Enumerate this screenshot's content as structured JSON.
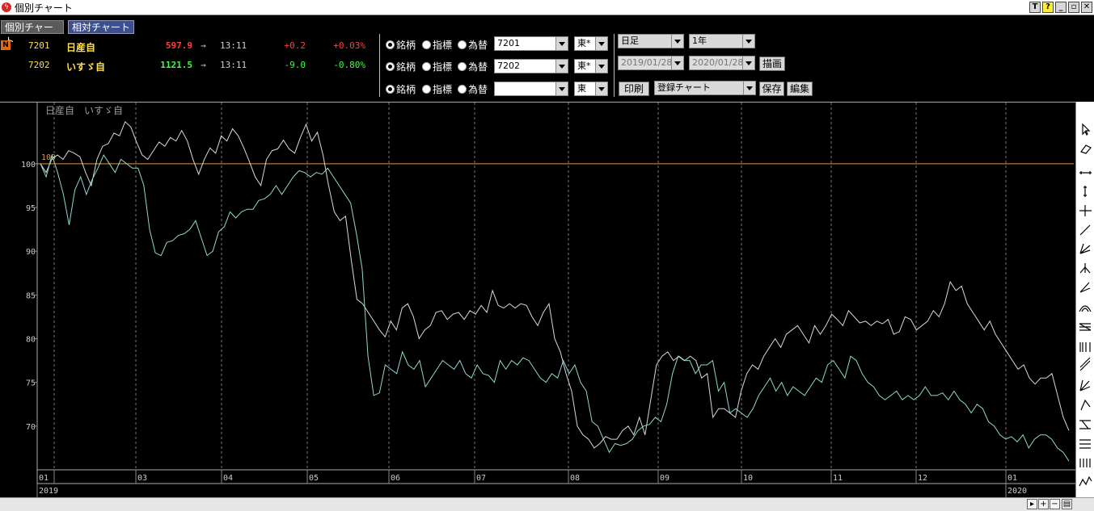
{
  "window": {
    "title": "個別チャート",
    "buttons": [
      "T",
      "?",
      "_",
      "▫",
      "✕"
    ]
  },
  "tabs": [
    {
      "label": "個別チャート",
      "active": false
    },
    {
      "label": "相対チャート",
      "active": true
    }
  ],
  "realtime_badge": "N",
  "quotes": [
    {
      "code": "7201",
      "name": "日産自",
      "price": "597.9",
      "price_color": "#ff4040",
      "arrow": "→",
      "time": "13:11",
      "change": "+0.2",
      "pct": "+0.03%",
      "change_color": "#ff4040"
    },
    {
      "code": "7202",
      "name": "いすゞ自",
      "price": "1121.5",
      "price_color": "#40ff40",
      "arrow": "→",
      "time": "13:11",
      "change": "-9.0",
      "pct": "-0.80%",
      "change_color": "#40ff40"
    }
  ],
  "selectors": [
    {
      "options": [
        "銘柄",
        "指標",
        "為替"
      ],
      "selected": 0,
      "code": "7201",
      "market": "東*"
    },
    {
      "options": [
        "銘柄",
        "指標",
        "為替"
      ],
      "selected": 0,
      "code": "7202",
      "market": "東*"
    },
    {
      "options": [
        "銘柄",
        "指標",
        "為替"
      ],
      "selected": 0,
      "code": "",
      "market": "東"
    }
  ],
  "controls": {
    "period": "日足",
    "span": "1年",
    "date_from": "2019/01/28",
    "date_to": "2020/01/28",
    "draw_button": "描画",
    "print_button": "印刷",
    "saved_chart": "登録チャート",
    "save_button": "保存",
    "edit_button": "編集"
  },
  "chart_data": {
    "type": "line",
    "legend": [
      "日産自",
      "いすゞ自"
    ],
    "baseline": 100,
    "baseline_label": "100",
    "ylim": [
      65,
      107
    ],
    "yticks": [
      70,
      75,
      80,
      85,
      90,
      95,
      100
    ],
    "x_month_labels": [
      "01",
      "03",
      "04",
      "05",
      "06",
      "07",
      "08",
      "09",
      "10",
      "11",
      "12",
      "01"
    ],
    "x_year_labels": [
      "2019",
      "2020"
    ],
    "series": [
      {
        "name": "日産自",
        "color": "#d8d8d8",
        "values": [
          100,
          99,
          100.5,
          101,
          100.5,
          101.5,
          101.2,
          100.8,
          99,
          97.5,
          100.5,
          102,
          102.3,
          103.5,
          103.2,
          104.8,
          104.2,
          102.5,
          101,
          100.5,
          101.5,
          102.5,
          102,
          103,
          102.6,
          103.8,
          102.6,
          100.5,
          98.8,
          100.5,
          101.8,
          101.2,
          103.2,
          102.6,
          104,
          103.2,
          101.8,
          100.2,
          98.5,
          97.5,
          100.5,
          101.5,
          101.7,
          102.7,
          101.7,
          101.2,
          103,
          104.5,
          102.6,
          103.6,
          101,
          97.5,
          94.5,
          93.5,
          94,
          89,
          84.5,
          84,
          83,
          82,
          81,
          80.2,
          82,
          81,
          83.5,
          84,
          82.5,
          80,
          81,
          81.5,
          83,
          83.2,
          82.2,
          82.8,
          83,
          82.2,
          83.2,
          82.8,
          83.8,
          83,
          85.5,
          83.8,
          83.5,
          84,
          83.5,
          84,
          83.8,
          82.5,
          81.5,
          83,
          84,
          80,
          78.5,
          76,
          74,
          70,
          69,
          68.5,
          67.5,
          68,
          68.8,
          68.5,
          68.5,
          69.5,
          70,
          69,
          71,
          69,
          73,
          77,
          78,
          78.5,
          77.5,
          78,
          77.5,
          78,
          77.5,
          75.5,
          76,
          71,
          72,
          72,
          71.5,
          71,
          74,
          76,
          77,
          76.5,
          78,
          79,
          80,
          79,
          80.5,
          81,
          81.5,
          80.5,
          79.5,
          81.5,
          80.5,
          81.5,
          82.8,
          82.2,
          81.5,
          83.2,
          82.5,
          81.8,
          82,
          81.5,
          82,
          81.7,
          82.2,
          80.5,
          80.8,
          82.5,
          82.2,
          81,
          81.5,
          82,
          83.2,
          82.5,
          84,
          86.5,
          85.5,
          86,
          84,
          83,
          82,
          81,
          82,
          80.5,
          79.5,
          78.5,
          77.5,
          76.5,
          77,
          75.5,
          74.8,
          75.5,
          75.5,
          76,
          73.5,
          71,
          69.5
        ]
      },
      {
        "name": "いすゞ自",
        "color": "#8fd8d0",
        "values": [
          100,
          98.5,
          101,
          99,
          96.5,
          93,
          97,
          98.5,
          96.5,
          98.2,
          99.5,
          101,
          100,
          99,
          100.5,
          100,
          99.5,
          99.5,
          97.5,
          92.5,
          89.8,
          89.5,
          91,
          91.2,
          91.8,
          92,
          92.5,
          93.5,
          91.5,
          89.5,
          90,
          92.2,
          92.8,
          94.5,
          93.8,
          94.5,
          94.8,
          94.8,
          95.8,
          96,
          96.5,
          97.5,
          96.5,
          97.5,
          98.5,
          99.2,
          99,
          98.5,
          99,
          98.8,
          99.5,
          98.5,
          97.5,
          96.5,
          95.5,
          92,
          88,
          78,
          73.5,
          73.8,
          77,
          76.5,
          76,
          78.5,
          77,
          76.5,
          77.5,
          74.5,
          75.5,
          76.5,
          77.5,
          77,
          76.5,
          77.5,
          76,
          75.5,
          77,
          76,
          75.8,
          75,
          77.5,
          76.5,
          77.5,
          77,
          77.8,
          77.5,
          76.5,
          75.5,
          75,
          76,
          75.5,
          77.5,
          76,
          77,
          75,
          74,
          70.5,
          70,
          68.5,
          67,
          68,
          67.8,
          68,
          68.5,
          69.5,
          70,
          70.2,
          71,
          70.5,
          72.5,
          76,
          78,
          77.5,
          77.5,
          76,
          77,
          77,
          77.5,
          74,
          75,
          71.5,
          72,
          71.5,
          71,
          72,
          73.5,
          74.5,
          75.5,
          74,
          75,
          73.5,
          74.5,
          74,
          73.5,
          74.5,
          75.5,
          75,
          77,
          77.5,
          76.5,
          75.5,
          78,
          77.5,
          76,
          75,
          74.5,
          73.5,
          73,
          73.5,
          74,
          73,
          73.5,
          73,
          73.5,
          74.5,
          73.5,
          73.5,
          73.8,
          73,
          74,
          73,
          72.5,
          71.5,
          72.5,
          72,
          70.5,
          70,
          69,
          68.5,
          68.8,
          68.2,
          69,
          67.5,
          68.5,
          69,
          69,
          68.5,
          67.5,
          67,
          66
        ]
      }
    ]
  },
  "toolbar_icons": [
    "cursor-icon",
    "eraser-icon",
    "horizontal-line-icon",
    "vertical-line-icon",
    "cross-line-icon",
    "trend-line-icon",
    "fan-line-icon",
    "pitchfork-icon",
    "fibonacci-fan-icon",
    "fibonacci-arc-icon",
    "fibonacci-retrace-icon",
    "fibonacci-time-icon",
    "parallel-line-icon",
    "gann-fan-icon",
    "speed-line-icon",
    "channel-icon",
    "regression-icon",
    "cycle-icon",
    "wave-icon"
  ]
}
